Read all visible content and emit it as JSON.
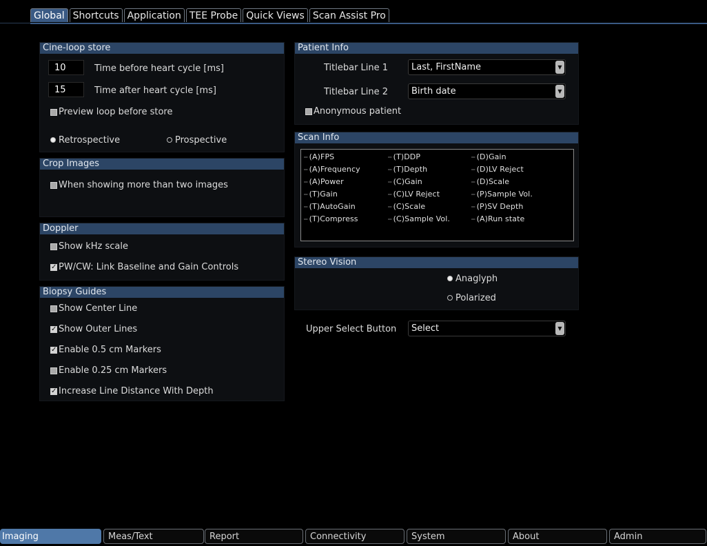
{
  "top_tabs": [
    "Global",
    "Shortcuts",
    "Application",
    "TEE Probe",
    "Quick Views",
    "Scan Assist Pro"
  ],
  "active_top_tab": "Global",
  "cine": {
    "title": "Cine-loop store",
    "before_value": "10",
    "before_label": "Time before heart cycle [ms]",
    "after_value": "15",
    "after_label": "Time after heart cycle [ms]",
    "preview_label": "Preview loop before store",
    "preview_checked": false,
    "retrospective_label": "Retrospective",
    "prospective_label": "Prospective",
    "selected_mode": "Retrospective"
  },
  "crop": {
    "title": "Crop Images",
    "option_label": "When showing more than two images",
    "option_checked": false
  },
  "doppler": {
    "title": "Doppler",
    "khz_label": "Show kHz scale",
    "khz_checked": false,
    "link_label": "PW/CW: Link Baseline and Gain Controls",
    "link_checked": true
  },
  "biopsy": {
    "title": "Biopsy Guides",
    "items": [
      {
        "label": "Show Center Line",
        "checked": false
      },
      {
        "label": "Show Outer Lines",
        "checked": true
      },
      {
        "label": "Enable 0.5 cm Markers",
        "checked": true
      },
      {
        "label": "Enable 0.25 cm Markers",
        "checked": false
      },
      {
        "label": "Increase Line Distance With Depth",
        "checked": true
      }
    ]
  },
  "patient": {
    "title": "Patient Info",
    "line1_label": "Titlebar Line 1",
    "line1_value": "Last, FirstName",
    "line2_label": "Titlebar Line 2",
    "line2_value": "Birth date",
    "anonymous_label": "Anonymous patient",
    "anonymous_checked": false
  },
  "scan_info": {
    "title": "Scan Info",
    "columns": [
      [
        "(A)FPS",
        "(A)Frequency",
        "(A)Power",
        "(T)Gain",
        "(T)AutoGain",
        "(T)Compress"
      ],
      [
        "(T)DDP",
        "(T)Depth",
        "(C)Gain",
        "(C)LV Reject",
        "(C)Scale",
        "(C)Sample Vol."
      ],
      [
        "(D)Gain",
        "(D)LV Reject",
        "(D)Scale",
        "(P)Sample Vol.",
        "(P)SV Depth",
        "(A)Run state"
      ]
    ]
  },
  "stereo": {
    "title": "Stereo Vision",
    "anaglyph_label": "Anaglyph",
    "polarized_label": "Polarized",
    "selected": "Anaglyph"
  },
  "upper_select": {
    "label": "Upper Select Button",
    "value": "Select"
  },
  "bottom_tabs": [
    "Imaging",
    "Meas/Text",
    "Report",
    "Connectivity",
    "System",
    "About",
    "Admin"
  ],
  "active_bottom_tab": "Imaging",
  "colors": {
    "group_header": "#2c4565",
    "active_top_tab": "#3a5a84",
    "active_bottom_tab": "#4f78a8",
    "background": "#000000"
  }
}
